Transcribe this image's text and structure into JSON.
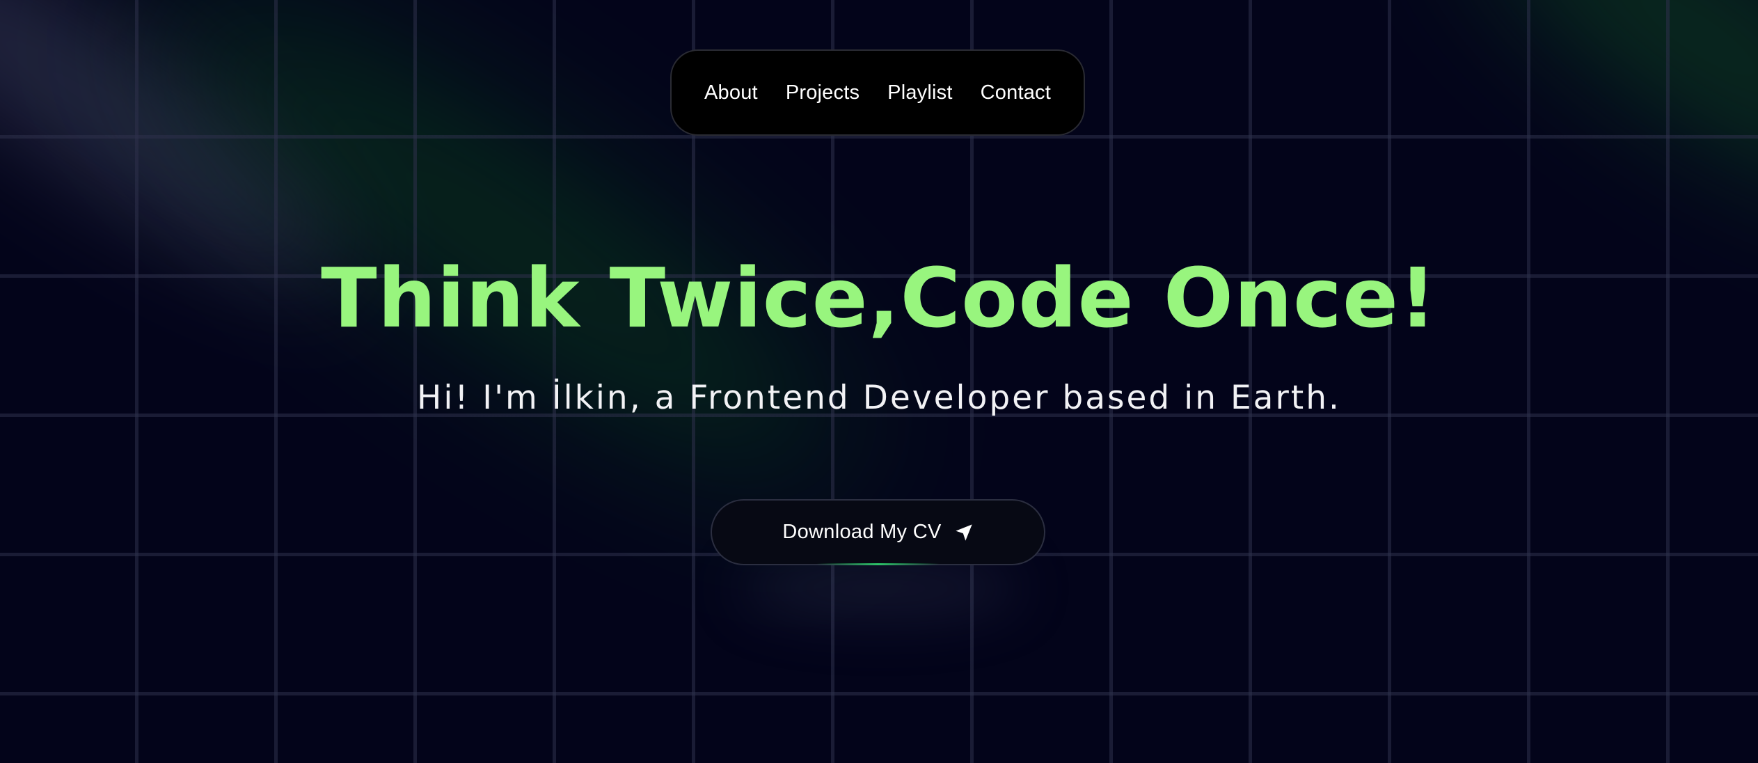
{
  "nav": {
    "items": [
      {
        "label": "About"
      },
      {
        "label": "Projects"
      },
      {
        "label": "Playlist"
      },
      {
        "label": "Contact"
      }
    ]
  },
  "hero": {
    "headline": "Think Twice,Code Once!",
    "subline": "Hi! I'm İlkin, a Frontend Developer based in Earth."
  },
  "cta": {
    "label": "Download My CV",
    "icon": "send-icon"
  },
  "colors": {
    "background": "#03041a",
    "accent": "#98f57e",
    "nav_background": "#000000",
    "glow_green": "#2ed26e"
  }
}
